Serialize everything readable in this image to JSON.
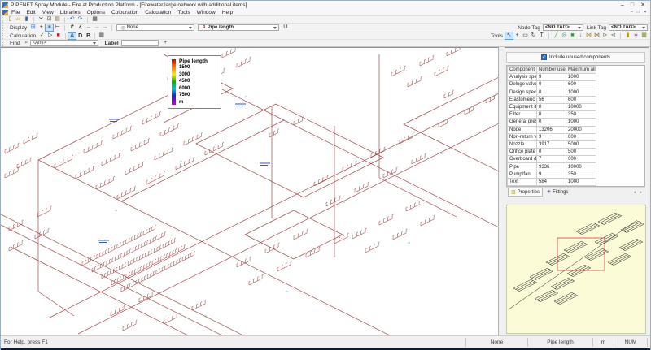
{
  "colors": {
    "canvas_line": "#a04a4a",
    "annotation_blue": "#3355cc",
    "cyan_tick": "#44aacc",
    "minimap_bg": "#fbfbd8",
    "minimap_line": "#1a1a1a",
    "viewport_red": "#cc4444",
    "accent_blue": "#2b5fb0"
  },
  "window": {
    "title": "PIPENET Spray Module - Fire at Production Platform - [Firewater large network with  additional items]",
    "controls": {
      "minimize": "–",
      "maximize": "□",
      "close": "✕"
    }
  },
  "menu": {
    "items": [
      "File",
      "Edit",
      "View",
      "Libraries",
      "Options",
      "Colouration",
      "Calculation",
      "Tools",
      "Window",
      "Help"
    ]
  },
  "toolbars": {
    "file": {
      "icons": [
        {
          "name": "new-file-icon",
          "glyph": "▯",
          "color": "#555"
        },
        {
          "name": "open-file-icon",
          "glyph": "▱",
          "color": "#c89a2a"
        },
        {
          "name": "save-icon",
          "glyph": "▮",
          "color": "#2b5fb0"
        },
        {
          "sep": true
        },
        {
          "name": "cut-icon",
          "glyph": "✂",
          "color": "#444"
        },
        {
          "name": "copy-icon",
          "glyph": "⊡",
          "color": "#444"
        },
        {
          "name": "paste-icon",
          "glyph": "▤",
          "color": "#7a6a3a"
        },
        {
          "sep": true
        },
        {
          "name": "undo-icon",
          "glyph": "↶",
          "color": "#2b5fb0"
        },
        {
          "name": "redo-icon",
          "glyph": "↷",
          "color": "#2b5fb0"
        },
        {
          "sep": true
        },
        {
          "name": "print-icon",
          "glyph": "▦",
          "color": "#444"
        }
      ]
    },
    "display": {
      "label": "Display",
      "icons": [
        {
          "name": "grid-icon",
          "glyph": "⊞",
          "color": "#2b5fb0"
        },
        {
          "name": "add-node-icon",
          "glyph": "+",
          "color": "#333"
        },
        {
          "name": "zoom-extents-icon",
          "glyph": "∗",
          "color": "#2b5fb0",
          "active": true
        },
        {
          "name": "fit-width-icon",
          "glyph": "⊢",
          "color": "#333"
        },
        {
          "sep": true
        },
        {
          "name": "redraw-icon",
          "glyph": "↱",
          "color": "#333"
        },
        {
          "name": "angle-label-icon",
          "glyph": "∡",
          "color": "#333"
        },
        {
          "name": "arrow-plain-icon",
          "glyph": "→",
          "color": "#333"
        },
        {
          "name": "arrow-flow-icon",
          "glyph": "→",
          "color": "#2b5fb0"
        },
        {
          "name": "arrow-result-icon",
          "glyph": "→",
          "color": "#c0392b"
        },
        {
          "sep": true
        }
      ],
      "view_dropdown_icon": "◎",
      "view_value": "None",
      "colouration_dropdown_icon": "A",
      "colouration_value": "Pipe length",
      "underline_button": "U"
    },
    "node_tag": {
      "label": "Node Tag",
      "value": "<NO TAG>"
    },
    "link_tag": {
      "label": "Link Tag",
      "value": "<NO TAG>"
    },
    "calculation": {
      "label": "Calculation",
      "icons": [
        {
          "name": "check-calculation-icon",
          "glyph": "✓",
          "color": "#2e7d32"
        },
        {
          "name": "run-calculation-icon",
          "glyph": "▷",
          "color": "#333"
        },
        {
          "name": "delete-results-icon",
          "glyph": "■",
          "color": "#cc2222"
        },
        {
          "sep": true
        }
      ],
      "letters": [
        {
          "name": "output-a-button",
          "label": "A",
          "active": true
        },
        {
          "name": "output-d-button",
          "label": "D"
        },
        {
          "name": "output-b-button",
          "label": "B"
        }
      ],
      "report_icon": {
        "name": "report-grid-icon",
        "glyph": "▦",
        "color": "#555"
      }
    },
    "tools": {
      "label": "Tools",
      "icons": [
        {
          "name": "select-tool",
          "glyph": "↖",
          "color": "#2b5fb0",
          "active": true
        },
        {
          "name": "pan-tool",
          "glyph": "+",
          "color": "#333"
        },
        {
          "name": "area-select-tool",
          "glyph": "▭",
          "color": "#333"
        },
        {
          "name": "zoom-tool",
          "glyph": "↻",
          "color": "#333"
        },
        {
          "name": "text-tool",
          "glyph": "T",
          "color": "#333"
        },
        {
          "sep": true
        },
        {
          "name": "pipe-tool",
          "glyph": "╱",
          "color": "#3a9a3a"
        },
        {
          "name": "nozzle-tool",
          "glyph": "◎",
          "color": "#2a8a8a"
        },
        {
          "name": "node-tool",
          "glyph": "■",
          "color": "#22aa22"
        },
        {
          "name": "elastomeric-valve-tool",
          "glyph": "↓",
          "color": "#7a3acc"
        },
        {
          "name": "non-return-valve-tool",
          "glyph": "⋈",
          "color": "#b8860b"
        },
        {
          "name": "deluge-valve-tool",
          "glyph": "⋈",
          "color": "#8a6a2a"
        },
        {
          "name": "pump-tool",
          "glyph": "⊳",
          "color": "#6a8a2a"
        },
        {
          "name": "spec-break-tool",
          "glyph": "⊲",
          "color": "#4a7a9a"
        },
        {
          "sep": true
        },
        {
          "name": "filter-tool",
          "glyph": "▮",
          "color": "#b8a000"
        },
        {
          "name": "orifice-plate-tool",
          "glyph": "∗",
          "color": "#8833aa"
        },
        {
          "name": "equipment-item-tool",
          "glyph": "▦",
          "color": "#8a8a22"
        }
      ]
    },
    "find": {
      "label": "Find",
      "any_value": "<Any>",
      "label_caption": "Label",
      "add_button": "+"
    }
  },
  "legend": {
    "title": "Pipe length",
    "values": [
      "1500",
      "3000",
      "4500",
      "6000",
      "7500"
    ],
    "unit": "m"
  },
  "panel": {
    "include_checkbox": "Include unused components",
    "checkmark": "✓",
    "columns": [
      "Component",
      "Number used",
      "Maximum all..."
    ],
    "rows": [
      [
        "Analysis spec...",
        "9",
        "1000"
      ],
      [
        "Deluge valve",
        "0",
        "600"
      ],
      [
        "Design spec...",
        "0",
        "1000"
      ],
      [
        "Elastomeric v...",
        "56",
        "600"
      ],
      [
        "Equipment it...",
        "0",
        "10000"
      ],
      [
        "Filter",
        "0",
        "350"
      ],
      [
        "General press...",
        "0",
        "1000"
      ],
      [
        "Node",
        "13206",
        "20000"
      ],
      [
        "Non-return v...",
        "9",
        "600"
      ],
      [
        "Nozzle",
        "3917",
        "5000"
      ],
      [
        "Orifice plate",
        "0",
        "500"
      ],
      [
        "Overboard d...",
        "7",
        "600"
      ],
      [
        "Pipe",
        "9336",
        "10000"
      ],
      [
        "Pump/fan",
        "9",
        "350"
      ],
      [
        "Text",
        "584",
        "1000"
      ]
    ],
    "tabs": [
      {
        "label": "Properties",
        "icon_name": "properties-grid-icon",
        "glyph": "▥",
        "color": "#a8a830",
        "active": true
      },
      {
        "label": "Fittings",
        "icon_name": "fittings-gear-icon",
        "glyph": "✳",
        "color": "#223a8c",
        "active": false
      }
    ],
    "tab_arrows": "◂ ▸"
  },
  "statusbar": {
    "help": "For Help, press F1",
    "cells": [
      "None",
      "Pipe length",
      "m",
      "NUM"
    ]
  }
}
